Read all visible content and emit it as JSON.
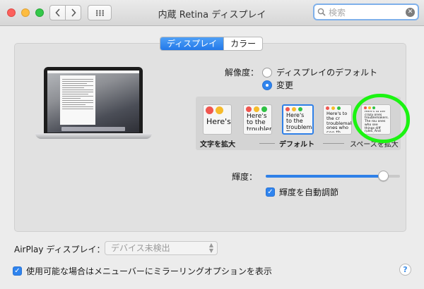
{
  "window": {
    "title": "内蔵 Retina ディスプレイ",
    "search_placeholder": "検索"
  },
  "tabs": [
    {
      "label": "ディスプレイ",
      "active": true
    },
    {
      "label": "カラー",
      "active": false
    }
  ],
  "resolution": {
    "label": "解像度：",
    "options": [
      {
        "label": "ディスプレイのデフォルト",
        "selected": false
      },
      {
        "label": "変更",
        "selected": true
      }
    ]
  },
  "scaling": {
    "options": [
      {
        "sample": "Here's",
        "selected": false
      },
      {
        "sample": "Here's to the troublemak",
        "selected": false
      },
      {
        "sample": "Here's to the troublemakers. The ones who se",
        "selected": true
      },
      {
        "sample": "Here's to the cr troublemakers. ones who see th rules. And they",
        "selected": false
      },
      {
        "sample": "Here's to the crazy ones troublemakers. The rou ones who see things diff rules. And they have no can quote them, disagr them. About the only th Because they change thi",
        "selected": false
      }
    ],
    "labels": {
      "larger_text": "文字を拡大",
      "default": "デフォルト",
      "more_space": "スペースを拡大"
    }
  },
  "brightness": {
    "label": "輝度：",
    "level": 0.91,
    "auto_adjust_label": "輝度を自動調節",
    "auto_adjust_checked": true
  },
  "airplay": {
    "label": "AirPlay ディスプレイ：",
    "selected": "デバイス未検出"
  },
  "mirroring": {
    "label": "使用可能な場合はメニューバーにミラーリングオプションを表示",
    "checked": true
  },
  "help_label": "?",
  "colors": {
    "accent": "#2f80e8",
    "highlight": "#1bf411"
  }
}
